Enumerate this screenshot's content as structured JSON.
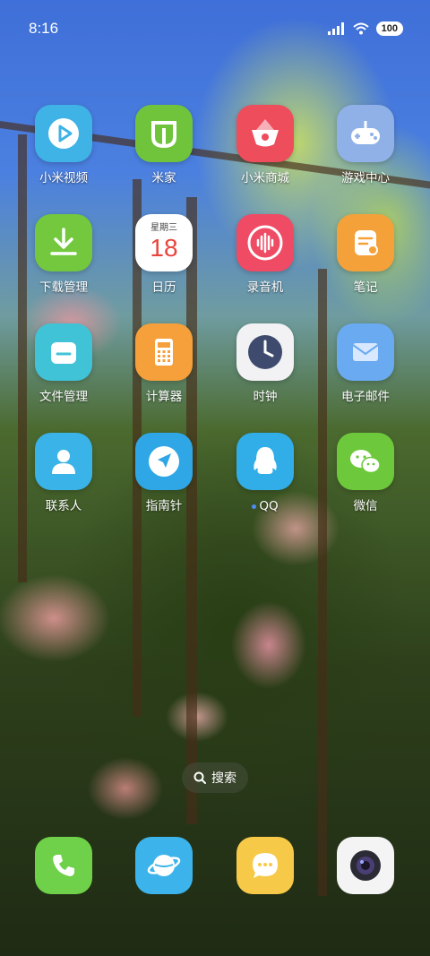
{
  "status_bar": {
    "time": "8:16",
    "battery": "100"
  },
  "apps": [
    {
      "label": "小米视频",
      "icon": "video-play-icon",
      "color": "#3fb2e6"
    },
    {
      "label": "米家",
      "icon": "mijia-icon",
      "color": "#6fc43c"
    },
    {
      "label": "小米商城",
      "icon": "shopping-basket-icon",
      "color": "#ee4d5b"
    },
    {
      "label": "游戏中心",
      "icon": "gamepad-icon",
      "color": "#8fb1e8"
    },
    {
      "label": "下载管理",
      "icon": "download-icon",
      "color": "#73c83d"
    },
    {
      "label": "日历",
      "icon": "calendar-icon",
      "color": "#ffffff",
      "weekday": "星期三",
      "day": "18"
    },
    {
      "label": "录音机",
      "icon": "voice-recorder-icon",
      "color": "#ef4b64"
    },
    {
      "label": "笔记",
      "icon": "notes-icon",
      "color": "#f5a13a"
    },
    {
      "label": "文件管理",
      "icon": "folder-icon",
      "color": "#41c3d7"
    },
    {
      "label": "计算器",
      "icon": "calculator-icon",
      "color": "#f5a03a"
    },
    {
      "label": "时钟",
      "icon": "clock-icon",
      "color": "#f2f2f4"
    },
    {
      "label": "电子邮件",
      "icon": "mail-icon",
      "color": "#6aaaf0"
    },
    {
      "label": "联系人",
      "icon": "contact-icon",
      "color": "#3ab3e9"
    },
    {
      "label": "指南针",
      "icon": "compass-icon",
      "color": "#2fa7e6"
    },
    {
      "label": "QQ",
      "icon": "qq-penguin-icon",
      "color": "#31aee8"
    },
    {
      "label": "微信",
      "icon": "wechat-icon",
      "color": "#6dc93b"
    }
  ],
  "search": {
    "label": "搜索"
  },
  "dock": [
    {
      "icon": "phone-icon",
      "color": "#6fd04a"
    },
    {
      "icon": "browser-icon",
      "color": "#3cb3ea"
    },
    {
      "icon": "messages-icon",
      "color": "#f7c948"
    },
    {
      "icon": "camera-icon",
      "color": "#f4f4f4"
    }
  ]
}
